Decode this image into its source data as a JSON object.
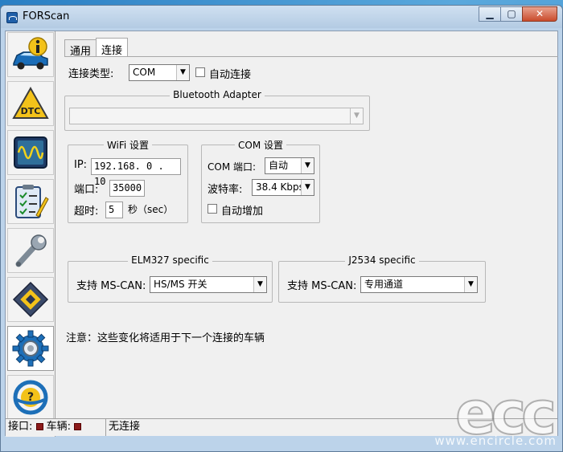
{
  "window": {
    "title": "FORScan"
  },
  "tabs": [
    {
      "label": "通用"
    },
    {
      "label": "连接"
    }
  ],
  "connection": {
    "type_label": "连接类型:",
    "type_value": "COM",
    "auto_connect_label": "自动连接",
    "auto_connect_checked": false
  },
  "bluetooth": {
    "title": "Bluetooth Adapter",
    "value": ""
  },
  "wifi": {
    "title": "WiFi 设置",
    "ip_label": "IP:",
    "ip_value": "192.168. 0 . 10",
    "port_label": "端口:",
    "port_value": "35000",
    "timeout_label": "超时:",
    "timeout_value": "5",
    "timeout_unit": "秒（sec）"
  },
  "com": {
    "title": "COM 设置",
    "port_label": "COM 端口:",
    "port_value": "自动",
    "baud_label": "波特率:",
    "baud_value": "38.4 Kbps",
    "auto_increase_label": "自动增加",
    "auto_increase_checked": false
  },
  "elm327": {
    "title": "ELM327 specific",
    "mscan_label": "支持 MS-CAN:",
    "mscan_value": "HS/MS 开关"
  },
  "j2534": {
    "title": "J2534 specific",
    "mscan_label": "支持 MS-CAN:",
    "mscan_value": "专用通道"
  },
  "note": "注意：这些变化将适用于下一个连接的车辆",
  "status_bar": {
    "interface_label": "接口:",
    "vehicle_label": "车辆:",
    "connection_status": "无连接",
    "indicator_color": "#8b1a1a"
  },
  "sidebar": {
    "items": [
      {
        "icon": "car-info-icon"
      },
      {
        "icon": "dtc-icon"
      },
      {
        "icon": "oscilloscope-icon"
      },
      {
        "icon": "checklist-icon"
      },
      {
        "icon": "wrench-icon"
      },
      {
        "icon": "chip-icon"
      },
      {
        "icon": "settings-gear-icon"
      },
      {
        "icon": "help-steering-wheel-icon"
      }
    ]
  },
  "watermark": {
    "logo": "ecc",
    "url": "www.encircle.com"
  },
  "colors": {
    "accent": "#1f5fa8",
    "window_frame": "#bcd3ea",
    "panel": "#f0f0f0"
  }
}
